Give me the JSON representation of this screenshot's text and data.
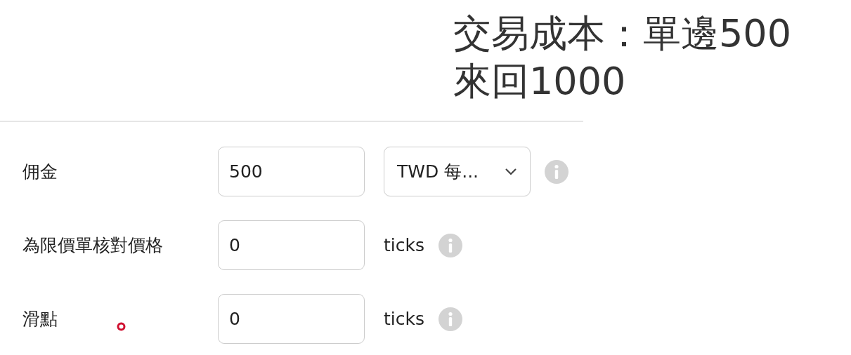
{
  "caption": {
    "lines": [
      "交易成本：單邊500",
      "來回1000"
    ]
  },
  "rows": [
    {
      "label": "佣金",
      "value": "500",
      "kind": "select",
      "unit": "TWD 每..."
    },
    {
      "label": "為限價單核對價格",
      "value": "0",
      "kind": "unit",
      "unit": "ticks"
    },
    {
      "label": "滑點",
      "value": "0",
      "kind": "unit",
      "unit": "ticks"
    }
  ]
}
